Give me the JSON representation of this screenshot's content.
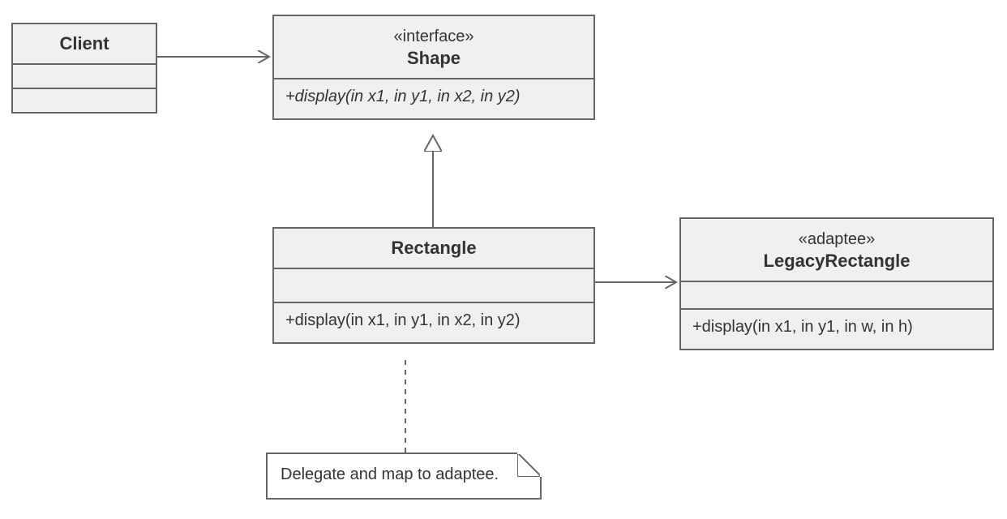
{
  "diagram": {
    "type": "uml-class-diagram",
    "pattern": "Adapter"
  },
  "boxes": {
    "client": {
      "title": "Client",
      "stereotype": "",
      "ops": ""
    },
    "shape": {
      "title": "Shape",
      "stereotype": "«interface»",
      "ops": "+display(in x1, in y1, in x2, in y2)"
    },
    "rectangle": {
      "title": "Rectangle",
      "stereotype": "",
      "ops": "+display(in x1, in y1, in x2, in y2)"
    },
    "legacy": {
      "title": "LegacyRectangle",
      "stereotype": "«adaptee»",
      "ops": "+display(in x1, in y1, in w, in h)"
    }
  },
  "note": {
    "text": "Delegate and map to adaptee."
  },
  "relationships": [
    {
      "from": "client",
      "to": "shape",
      "kind": "association-open-arrow"
    },
    {
      "from": "rectangle",
      "to": "shape",
      "kind": "realization-hollow-triangle"
    },
    {
      "from": "rectangle",
      "to": "legacy",
      "kind": "association-open-arrow"
    },
    {
      "from": "note",
      "to": "rectangle",
      "kind": "note-anchor-dashed"
    }
  ]
}
